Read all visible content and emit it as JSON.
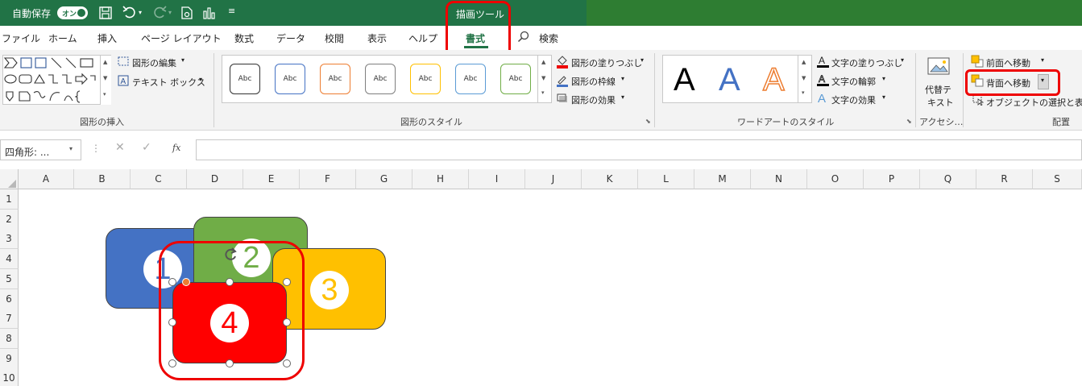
{
  "titlebar": {
    "autosave_label": "自動保存",
    "autosave_state": "オン",
    "context_tab": "描画ツール"
  },
  "menu": {
    "items": [
      "ファイル",
      "ホーム",
      "挿入",
      "ページ レイアウト",
      "数式",
      "データ",
      "校閲",
      "表示",
      "ヘルプ",
      "書式"
    ],
    "search_label": "検索"
  },
  "ribbon": {
    "insert_shapes": {
      "edit_shape": "図形の編集",
      "text_box": "テキスト ボックス",
      "group_label": "図形の挿入"
    },
    "shape_styles": {
      "style_label": "Abc",
      "fill": "図形の塗りつぶし",
      "outline": "図形の枠線",
      "effects": "図形の効果",
      "group_label": "図形のスタイル"
    },
    "wordart": {
      "letter": "A",
      "text_fill": "文字の塗りつぶし",
      "text_outline": "文字の輪郭",
      "text_effects": "文字の効果",
      "group_label": "ワードアートのスタイル"
    },
    "accessibility": {
      "alt_text_line1": "代替テ",
      "alt_text_line2": "キスト",
      "group_label": "アクセシ…"
    },
    "arrange": {
      "bring_forward": "前面へ移動",
      "send_backward": "背面へ移動",
      "selection_pane": "オブジェクトの選択と表示",
      "group_label": "配置"
    }
  },
  "formula_bar": {
    "name_box": "四角形: ...",
    "fx": "fx",
    "formula": ""
  },
  "sheet": {
    "columns": [
      "A",
      "B",
      "C",
      "D",
      "E",
      "F",
      "G",
      "H",
      "I",
      "J",
      "K",
      "L",
      "M",
      "N",
      "O",
      "P",
      "Q",
      "R",
      "S"
    ],
    "rows": [
      "1",
      "2",
      "3",
      "4",
      "5",
      "6",
      "7",
      "8",
      "9",
      "10"
    ]
  },
  "shapes": [
    {
      "label": "1",
      "color": "#4472c4"
    },
    {
      "label": "2",
      "color": "#70ad47"
    },
    {
      "label": "3",
      "color": "#ffc000"
    },
    {
      "label": "4",
      "color": "#ff0000"
    }
  ],
  "colors": {
    "titlebar": "#217346",
    "accent_green": "#217346",
    "highlight": "#e00000"
  }
}
